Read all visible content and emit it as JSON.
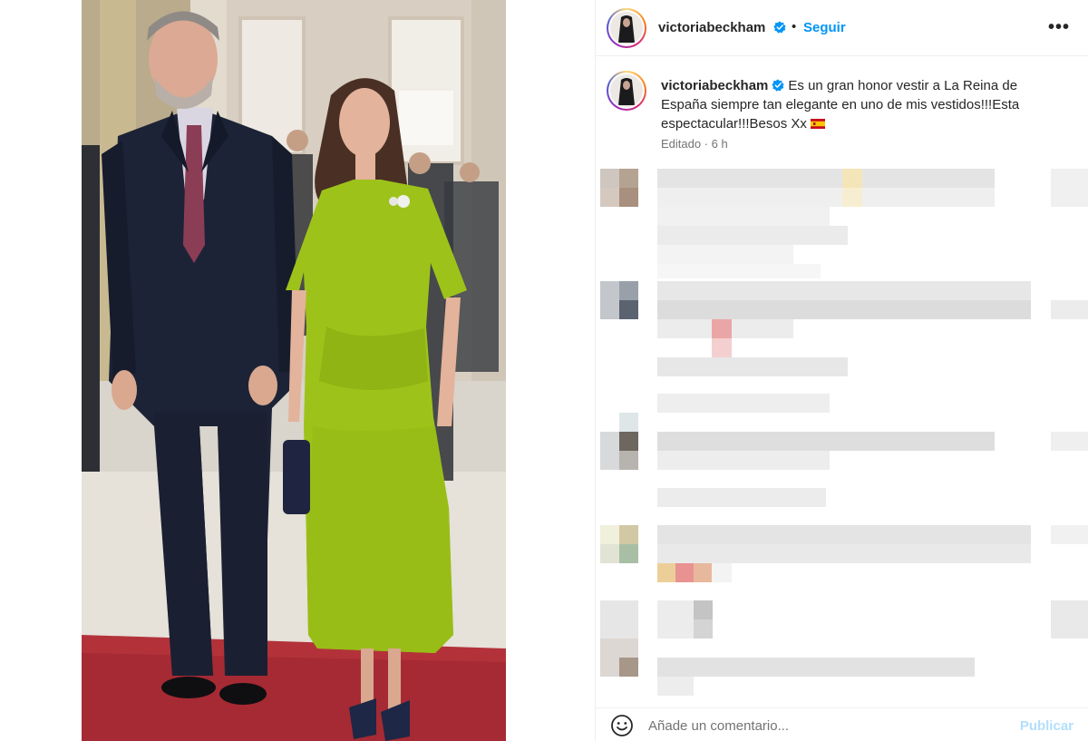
{
  "post": {
    "username": "victoriabeckham",
    "separator": "•",
    "follow_label": "Seguir",
    "more_label": "•••",
    "photo_alt": "King and Queen of Spain on red carpet"
  },
  "caption": {
    "username": "victoriabeckham",
    "text": "Es un gran honor vestir a La Reina de España siempre tan elegante en uno de mis vestidos!!!Esta espectacular!!!Besos Xx",
    "flag_icon": "spain-flag-icon",
    "meta": "Editado · 6 h"
  },
  "comment_box": {
    "placeholder": "Añade un comentario...",
    "publish_label": "Publicar"
  },
  "icons": {
    "verified": "verified-badge-icon",
    "more": "more-options-icon",
    "emoji": "emoji-icon"
  },
  "colors": {
    "follow_blue": "#0095f6",
    "publish_disabled": "#b2dffc",
    "verified_blue": "#0095f6",
    "dress_green": "#9dc31a"
  },
  "comments": [
    {
      "name": "blurred-comment-1"
    },
    {
      "name": "blurred-comment-2"
    },
    {
      "name": "blurred-comment-3"
    },
    {
      "name": "blurred-comment-4"
    },
    {
      "name": "blurred-comment-5"
    }
  ]
}
